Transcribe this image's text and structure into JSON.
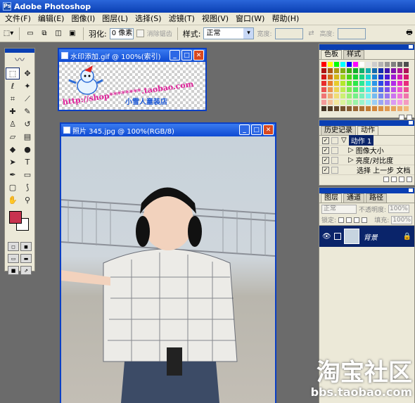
{
  "app": {
    "title": "Adobe Photoshop",
    "icon": "photoshop-icon"
  },
  "menu": [
    "文件(F)",
    "编辑(E)",
    "图像(I)",
    "图层(L)",
    "选择(S)",
    "滤镜(T)",
    "视图(V)",
    "窗口(W)",
    "帮助(H)"
  ],
  "options": {
    "feather_label": "羽化:",
    "feather_value": "0 像素",
    "antialias_label": "消除锯齿",
    "style_label": "样式:",
    "style_value": "正常",
    "width_label": "宽度:",
    "height_label": "高度:"
  },
  "colors": {
    "foreground": "#c8334f",
    "background": "#ffffff",
    "accent": "#0a3fb3"
  },
  "doc_watermark": {
    "title": "水印添加.gif @ 100%(索引)",
    "content_url": "http://shop********.taobao.com",
    "content_name": "小雪人童装店"
  },
  "doc_photo": {
    "title": "照片 345.jpg @ 100%(RGB/8)"
  },
  "swatches_panel": {
    "tabs": [
      "色板",
      "样式"
    ]
  },
  "actions_panel": {
    "tabs": [
      "历史记录",
      "动作"
    ],
    "items": [
      "动作 1",
      "图像大小",
      "亮度/对比度",
      "选择 上一步 文档"
    ]
  },
  "layers_panel": {
    "tabs": [
      "图层",
      "通道",
      "路径"
    ],
    "blend_mode": "正常",
    "opacity_label": "不透明度:",
    "opacity_value": "100%",
    "lock_label": "锁定:",
    "fill_label": "填充:",
    "fill_value": "100%",
    "layer_name": "背景"
  },
  "site_watermark": {
    "brand": "淘宝社区",
    "url": "bbs.taobao.com"
  }
}
